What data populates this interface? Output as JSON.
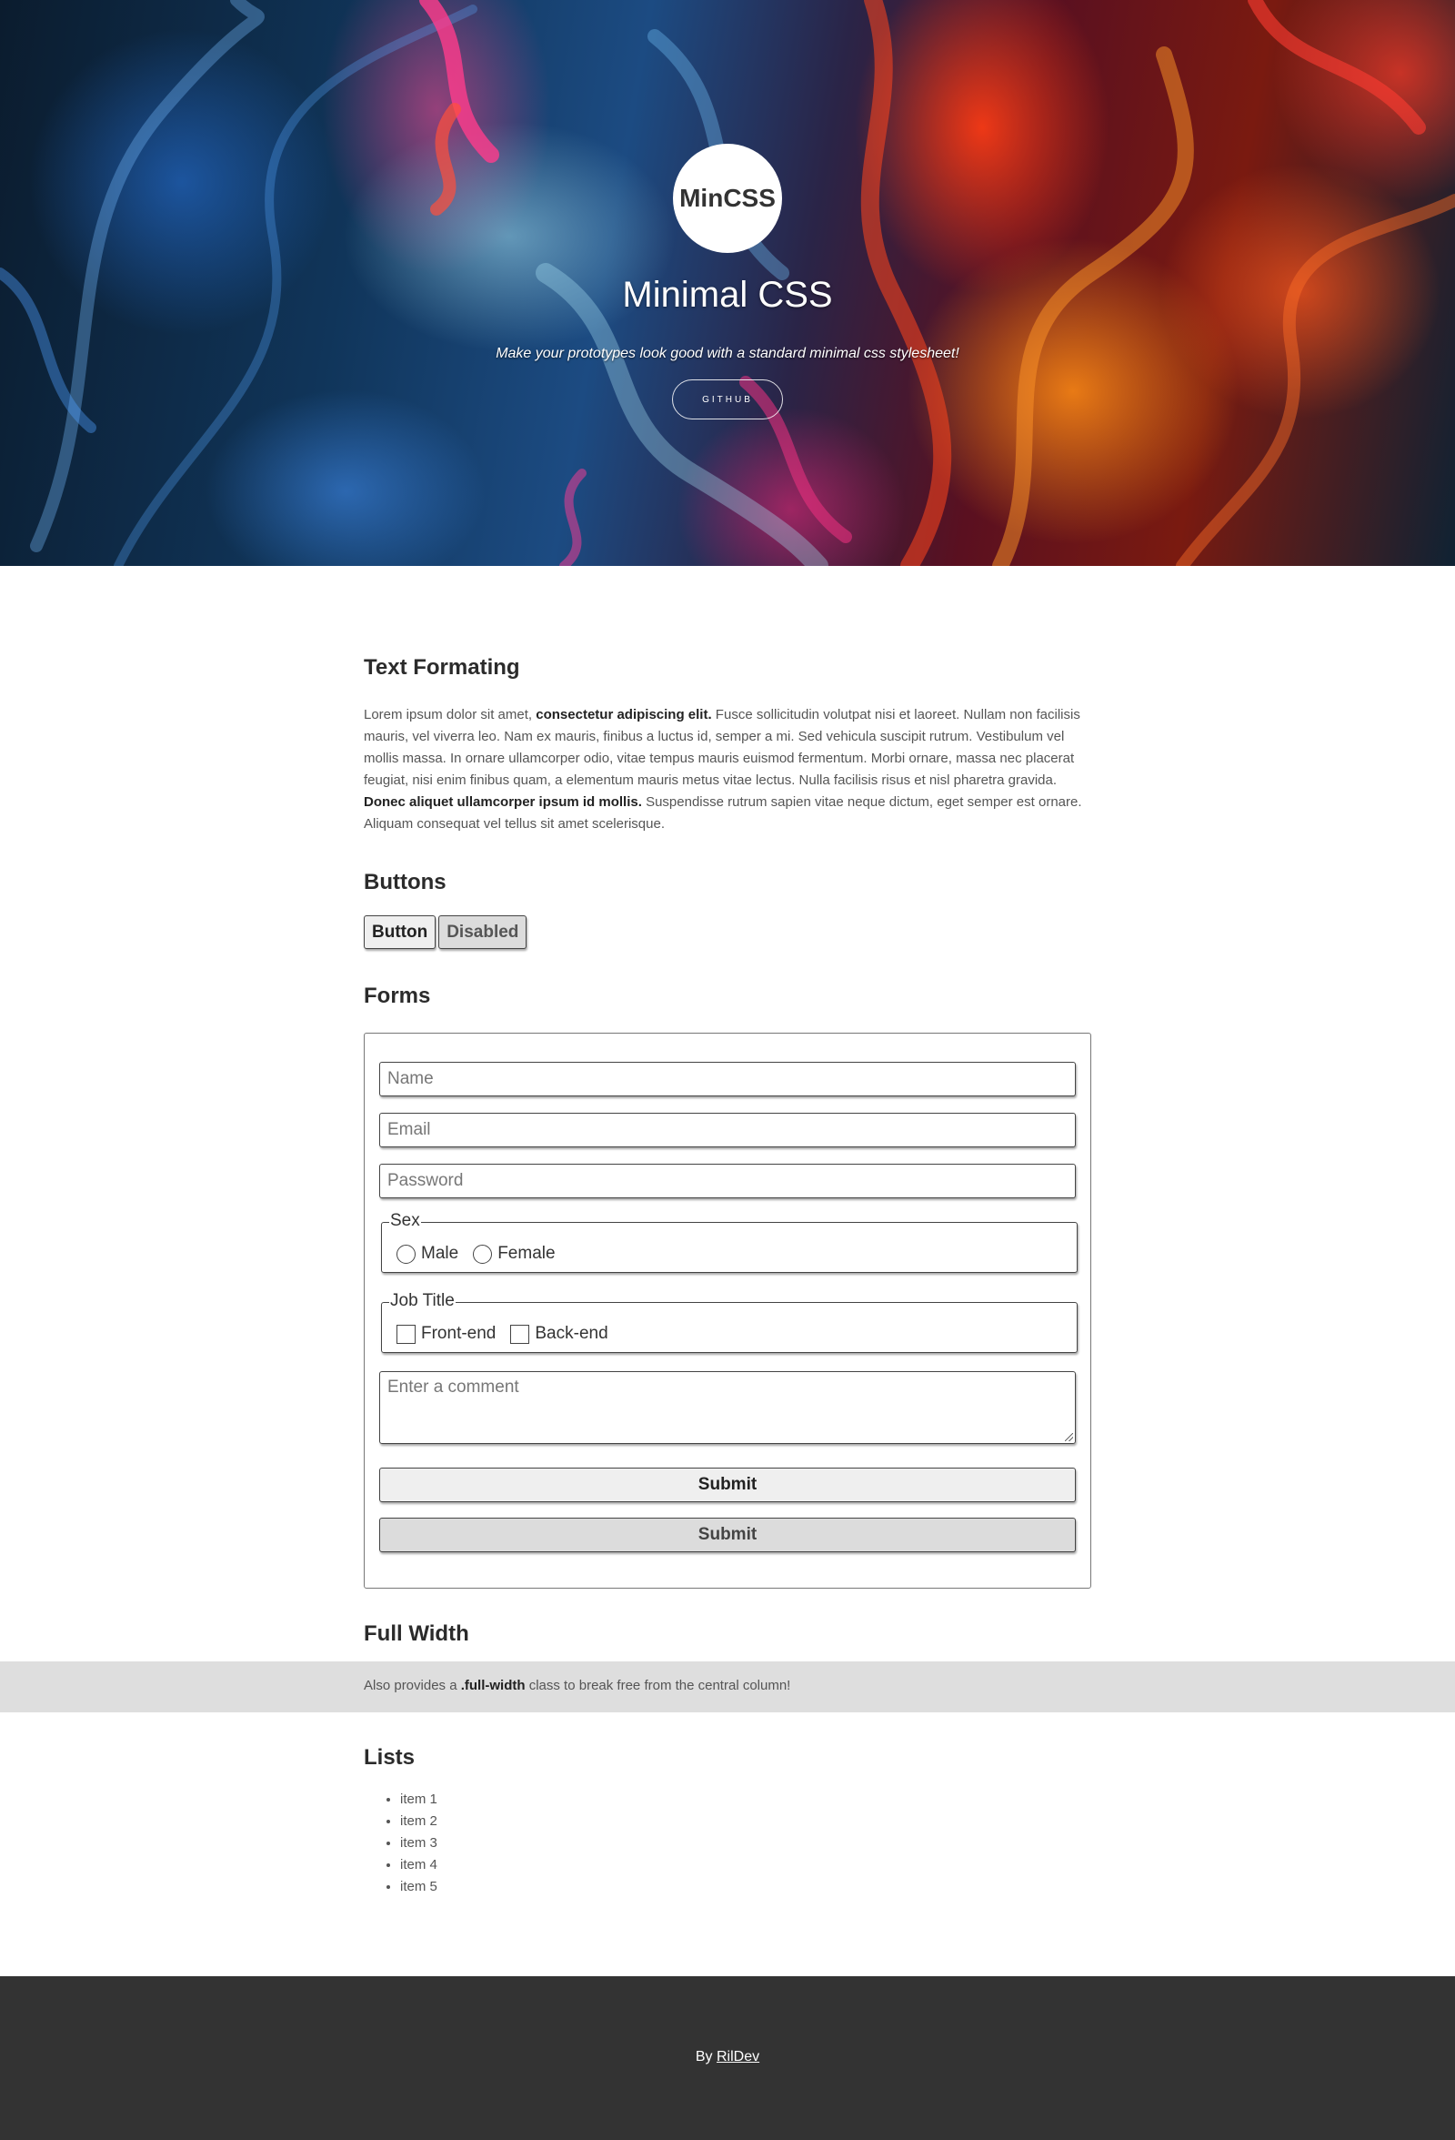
{
  "hero": {
    "logo_text": "MinCSS",
    "title": "Minimal CSS",
    "subtitle": "Make your prototypes look good with a standard minimal css stylesheet!",
    "github_button": "GITHUB"
  },
  "text_formatting": {
    "heading": "Text Formating",
    "p1": "Lorem ipsum dolor sit amet, ",
    "b1": "consectetur adipiscing elit.",
    "p2": " Fusce sollicitudin volutpat nisi et laoreet. Nullam non facilisis mauris, vel viverra leo. Nam ex mauris, finibus a luctus id, semper a mi. Sed vehicula suscipit rutrum. Vestibulum vel mollis massa. In ornare ullamcorper odio, vitae tempus mauris euismod fermentum. Morbi ornare, massa nec placerat feugiat, nisi enim finibus quam, a elementum mauris metus vitae lectus. Nulla facilisis risus et nisl pharetra gravida. ",
    "b2": "Donec aliquet ullamcorper ipsum id mollis.",
    "p3": " Suspendisse rutrum sapien vitae neque dictum, eget semper est ornare. Aliquam consequat vel tellus sit amet scelerisque."
  },
  "buttons": {
    "heading": "Buttons",
    "button_label": "Button",
    "disabled_label": "Disabled"
  },
  "forms": {
    "heading": "Forms",
    "name_placeholder": "Name",
    "email_placeholder": "Email",
    "password_placeholder": "Password",
    "sex_legend": "Sex",
    "sex_options": [
      "Male",
      "Female"
    ],
    "job_legend": "Job Title",
    "job_options": [
      "Front-end",
      "Back-end"
    ],
    "comment_placeholder": "Enter a comment",
    "submit_label": "Submit",
    "submit_disabled_label": "Submit"
  },
  "full_width": {
    "heading": "Full Width",
    "text_before": "Also provides a ",
    "class_name": ".full-width",
    "text_after": " class to break free from the central column!"
  },
  "lists": {
    "heading": "Lists",
    "items": [
      "item 1",
      "item 2",
      "item 3",
      "item 4",
      "item 5"
    ]
  },
  "footer": {
    "prefix": "By ",
    "author_link": "RilDev"
  }
}
